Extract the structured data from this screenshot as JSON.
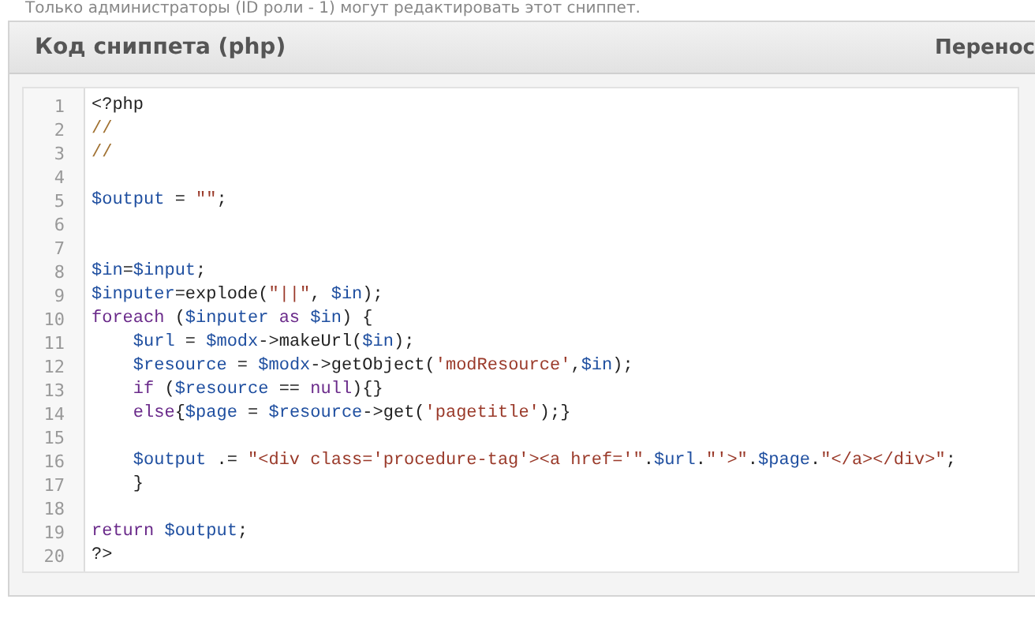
{
  "notice": "Только администраторы (ID роли - 1) могут редактировать этот сниппет.",
  "panel": {
    "title": "Код сниппета (php)",
    "header_right": "Перенос"
  },
  "code": {
    "lines": [
      {
        "number": "1",
        "tokens": [
          {
            "kind": "plain",
            "text": "<?php"
          }
        ]
      },
      {
        "number": "2",
        "tokens": [
          {
            "kind": "comment",
            "text": "//"
          }
        ]
      },
      {
        "number": "3",
        "tokens": [
          {
            "kind": "comment",
            "text": "//"
          }
        ]
      },
      {
        "number": "4"
      },
      {
        "number": "5",
        "tokens": [
          {
            "kind": "var",
            "text": "$output"
          },
          {
            "kind": "plain",
            "text": " = "
          },
          {
            "kind": "string",
            "text": "\"\""
          },
          {
            "kind": "plain",
            "text": ";"
          }
        ]
      },
      {
        "number": "6"
      },
      {
        "number": "7"
      },
      {
        "number": "8",
        "tokens": [
          {
            "kind": "var",
            "text": "$in"
          },
          {
            "kind": "plain",
            "text": "="
          },
          {
            "kind": "var",
            "text": "$input"
          },
          {
            "kind": "plain",
            "text": ";"
          }
        ]
      },
      {
        "number": "9",
        "tokens": [
          {
            "kind": "var",
            "text": "$inputer"
          },
          {
            "kind": "plain",
            "text": "=explode("
          },
          {
            "kind": "string",
            "text": "\"||\""
          },
          {
            "kind": "plain",
            "text": ", "
          },
          {
            "kind": "var",
            "text": "$in"
          },
          {
            "kind": "plain",
            "text": ");"
          }
        ]
      },
      {
        "number": "10",
        "tokens": [
          {
            "kind": "keyword",
            "text": "foreach"
          },
          {
            "kind": "plain",
            "text": " ("
          },
          {
            "kind": "var",
            "text": "$inputer"
          },
          {
            "kind": "keyword",
            "text": " as "
          },
          {
            "kind": "var",
            "text": "$in"
          },
          {
            "kind": "plain",
            "text": ") {"
          }
        ]
      },
      {
        "number": "11",
        "tokens": [
          {
            "kind": "var",
            "text": "    $url"
          },
          {
            "kind": "plain",
            "text": " = "
          },
          {
            "kind": "var",
            "text": "$modx"
          },
          {
            "kind": "plain",
            "text": "->makeUrl("
          },
          {
            "kind": "var",
            "text": "$in"
          },
          {
            "kind": "plain",
            "text": ");"
          }
        ]
      },
      {
        "number": "12",
        "tokens": [
          {
            "kind": "var",
            "text": "    $resource"
          },
          {
            "kind": "plain",
            "text": " = "
          },
          {
            "kind": "var",
            "text": "$modx"
          },
          {
            "kind": "plain",
            "text": "->getObject("
          },
          {
            "kind": "string",
            "text": "'modResource'"
          },
          {
            "kind": "plain",
            "text": ","
          },
          {
            "kind": "var",
            "text": "$in"
          },
          {
            "kind": "plain",
            "text": ");"
          }
        ]
      },
      {
        "number": "13",
        "tokens": [
          {
            "kind": "keyword",
            "text": "    if"
          },
          {
            "kind": "plain",
            "text": " ("
          },
          {
            "kind": "var",
            "text": "$resource"
          },
          {
            "kind": "plain",
            "text": " == "
          },
          {
            "kind": "keyword",
            "text": "null"
          },
          {
            "kind": "plain",
            "text": "){}"
          }
        ]
      },
      {
        "number": "14",
        "tokens": [
          {
            "kind": "keyword",
            "text": "    else"
          },
          {
            "kind": "plain",
            "text": "{"
          },
          {
            "kind": "var",
            "text": "$page"
          },
          {
            "kind": "plain",
            "text": " = "
          },
          {
            "kind": "var",
            "text": "$resource"
          },
          {
            "kind": "plain",
            "text": "->get("
          },
          {
            "kind": "string",
            "text": "'pagetitle'"
          },
          {
            "kind": "plain",
            "text": ");}"
          }
        ]
      },
      {
        "number": "15"
      },
      {
        "number": "16",
        "tokens": [
          {
            "kind": "var",
            "text": "    $output"
          },
          {
            "kind": "plain",
            "text": " .= "
          },
          {
            "kind": "string",
            "text": "\"<div class='procedure-tag'><a href='\""
          },
          {
            "kind": "plain",
            "text": "."
          },
          {
            "kind": "var",
            "text": "$url"
          },
          {
            "kind": "plain",
            "text": "."
          },
          {
            "kind": "string",
            "text": "\"'>\""
          },
          {
            "kind": "plain",
            "text": "."
          },
          {
            "kind": "var",
            "text": "$page"
          },
          {
            "kind": "plain",
            "text": "."
          },
          {
            "kind": "string",
            "text": "\"</a></div>\""
          },
          {
            "kind": "plain",
            "text": ";"
          }
        ]
      },
      {
        "number": "17",
        "tokens": [
          {
            "kind": "plain",
            "text": "    }"
          }
        ]
      },
      {
        "number": "18"
      },
      {
        "number": "19",
        "tokens": [
          {
            "kind": "keyword",
            "text": "return "
          },
          {
            "kind": "var",
            "text": "$output"
          },
          {
            "kind": "plain",
            "text": ";"
          }
        ]
      },
      {
        "number": "20",
        "tokens": [
          {
            "kind": "plain",
            "text": "?>"
          }
        ]
      }
    ]
  }
}
